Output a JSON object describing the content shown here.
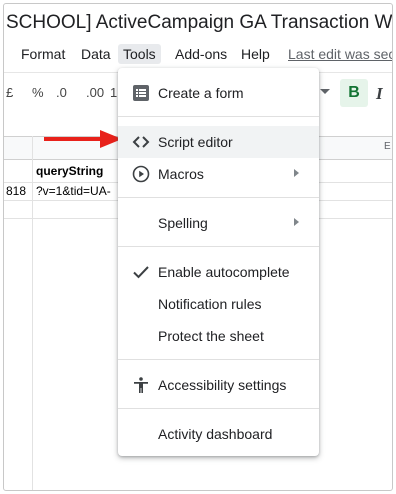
{
  "document": {
    "title": "SCHOOL] ActiveCampaign GA Transaction Webh"
  },
  "menubar": {
    "items": [
      "Format",
      "Data",
      "Tools",
      "Add-ons",
      "Help"
    ],
    "last_edit": "Last edit was sec"
  },
  "toolbar": {
    "currency": "£",
    "percent": "%",
    "dec_decrease": ".0",
    "dec_increase": ".00",
    "more_formats": "1",
    "bold": "B",
    "italic": "I"
  },
  "sheet": {
    "column_header": "E",
    "row1": {
      "col_b": "queryString"
    },
    "row2": {
      "col_a": "818",
      "col_b": "?v=1&tid=UA-"
    }
  },
  "tools_menu": {
    "items": [
      {
        "label": "Create a form",
        "icon": "form-icon"
      },
      {
        "label": "Script editor",
        "icon": "code-icon"
      },
      {
        "label": "Macros",
        "icon": "play-circle-icon"
      },
      {
        "label": "Spelling"
      },
      {
        "label": "Enable autocomplete",
        "icon": "checkmark-icon"
      },
      {
        "label": "Notification rules"
      },
      {
        "label": "Protect the sheet"
      },
      {
        "label": "Accessibility settings",
        "icon": "accessibility-icon"
      },
      {
        "label": "Activity dashboard"
      }
    ]
  },
  "colors": {
    "arrow": "#e8211b",
    "bold_bg": "#e6f4ea",
    "bold_fg": "#137333",
    "menu_hover": "#f1f3f4"
  }
}
